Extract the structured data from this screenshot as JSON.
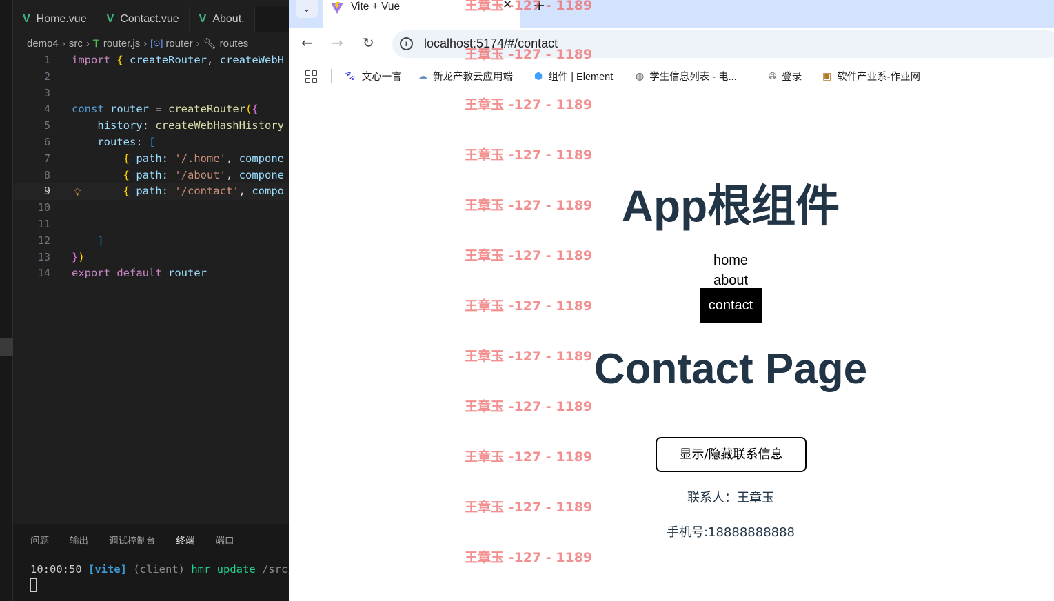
{
  "editor": {
    "tabs": [
      "Home.vue",
      "Contact.vue",
      "About."
    ],
    "breadcrumb": [
      "demo4",
      "src",
      "router.js",
      "router",
      "routes"
    ],
    "code_lines": [
      "import { createRouter, createWebH",
      "",
      "",
      "const router = createRouter({",
      "    history: createWebHashHistory",
      "    routes: [",
      "        { path: '/.home', compone",
      "        { path: '/about', compone",
      "        { path: '/contact', compo",
      "",
      "",
      "    ]",
      "})",
      "export default router"
    ],
    "line_numbers": [
      "1",
      "2",
      "3",
      "4",
      "5",
      "6",
      "7",
      "8",
      "9",
      "10",
      "11",
      "12",
      "13",
      "14"
    ],
    "panel_tabs": [
      "问题",
      "输出",
      "调试控制台",
      "终端",
      "端口"
    ],
    "active_panel_tab": "终端",
    "terminal": {
      "time": "10:00:50",
      "tag": "[vite]",
      "client": "(client)",
      "msg": "hmr update",
      "path": "/src/A"
    }
  },
  "browser": {
    "tab_title": "Vite + Vue",
    "url": "localhost:5174/#/contact",
    "bookmarks": [
      "文心一言",
      "新龙产教云应用端",
      "组件 | Element",
      "学生信息列表 - 电...",
      "登录",
      "软件产业系-作业网"
    ]
  },
  "page": {
    "app_title": "App根组件",
    "nav": [
      "home",
      "about",
      "contact"
    ],
    "active_nav": "contact",
    "contact_title": "Contact Page",
    "toggle_button": "显示/隐藏联系信息",
    "contact_person": "联系人：王章玉",
    "phone": "手机号:18888888888",
    "watermark": "王章玉 -127 - 1189"
  },
  "colors": {
    "heading": "#213547",
    "watermark": "#ee6464",
    "vue_green": "#41b883",
    "tabstrip": "#d3e3fd"
  }
}
